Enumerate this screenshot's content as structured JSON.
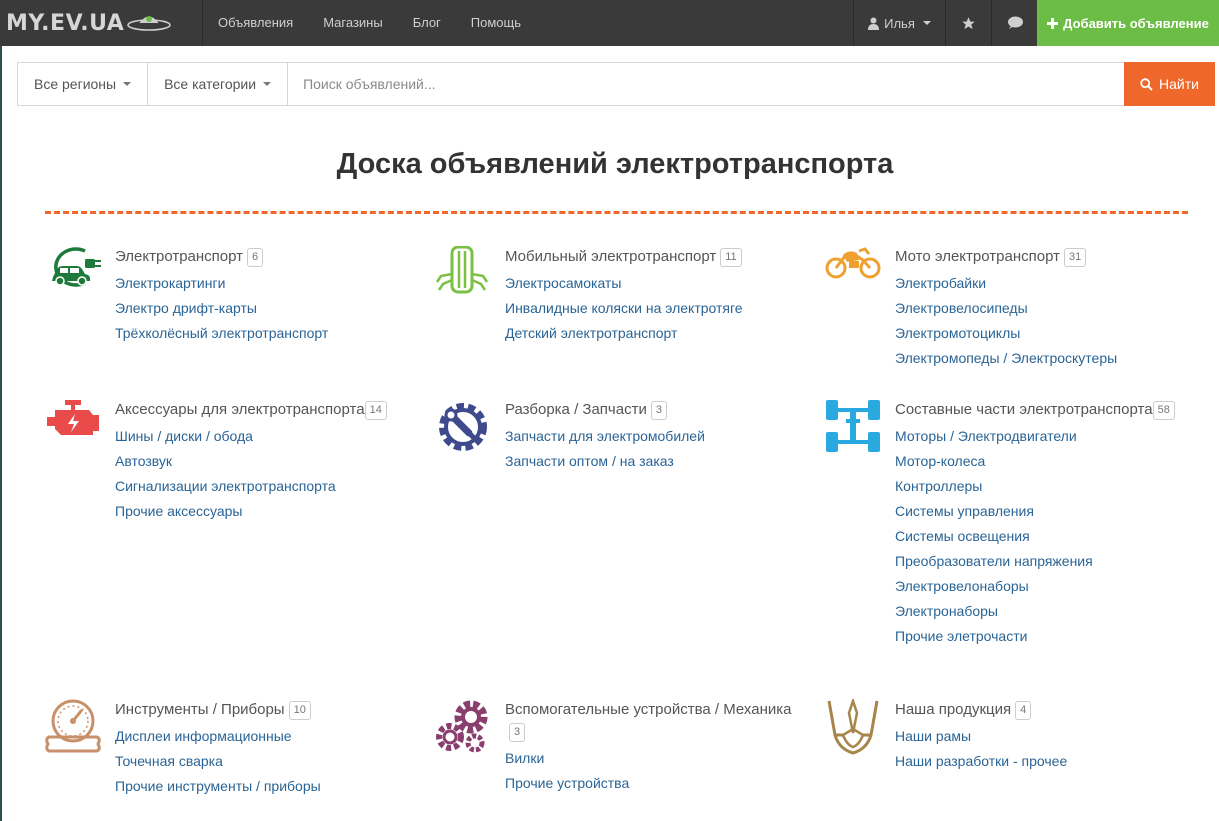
{
  "nav": {
    "brand": "MY.EV.UA",
    "links": [
      "Объявления",
      "Магазины",
      "Блог",
      "Помощь"
    ],
    "user_name": "Илья",
    "add_button": "Добавить объявление"
  },
  "search": {
    "region": "Все регионы",
    "category": "Все категории",
    "placeholder": "Поиск объявлений...",
    "button": "Найти"
  },
  "page_title": "Доска объявлений электротранспорта",
  "colors": {
    "accent": "#f0672b",
    "green": "#6cbd45",
    "link": "#2a6496",
    "navbar": "#3a3a3a"
  },
  "categories": [
    {
      "title": "Электротранспорт",
      "count": "6",
      "icon": "electric-car-icon",
      "links": [
        "Электрокартинги",
        "Электро дрифт-карты",
        "Трёхколёсный электротранспорт"
      ]
    },
    {
      "title": "Мобильный электротранспорт",
      "count": "11",
      "icon": "scooter-icon",
      "links": [
        "Электросамокаты",
        "Инвалидные коляски на электротяге",
        "Детский электротранспорт"
      ]
    },
    {
      "title": "Мото электротранспорт",
      "count": "31",
      "icon": "motorcycle-icon",
      "links": [
        "Электробайки",
        "Электровелосипеды",
        "Электромотоциклы",
        "Электромопеды / Электроскутеры"
      ]
    },
    {
      "title": "Аксессуары для электротранспорта",
      "count": "14",
      "icon": "engine-icon",
      "links": [
        "Шины / диски / обода",
        "Автозвук",
        "Сигнализации электротранспорта",
        "Прочие аксессуары"
      ]
    },
    {
      "title": "Разборка / Запчасти",
      "count": "3",
      "icon": "wrench-gear-icon",
      "links": [
        "Запчасти для электромобилей",
        "Запчасти оптом / на заказ"
      ]
    },
    {
      "title": "Составные части электротранспорта",
      "count": "58",
      "icon": "chassis-icon",
      "links": [
        "Моторы / Электродвигатели",
        "Мотор-колеса",
        "Контроллеры",
        "Системы управления",
        "Системы освещения",
        "Преобразователи напряжения",
        "Электровелонаборы",
        "Электронаборы",
        "Прочие элетрочасти"
      ]
    },
    {
      "title": "Инструменты / Приборы",
      "count": "10",
      "icon": "gauge-icon",
      "links": [
        "Дисплеи информационные",
        "Точечная сварка",
        "Прочие инструменты / приборы"
      ]
    },
    {
      "title": "Вспомогательные устройства / Механика",
      "count": "3",
      "icon": "gears-icon",
      "links": [
        "Вилки",
        "Прочие устройства"
      ]
    },
    {
      "title": "Наша продукция",
      "count": "4",
      "icon": "trident-icon",
      "links": [
        "Наши рамы",
        "Наши разработки - прочее"
      ]
    }
  ]
}
